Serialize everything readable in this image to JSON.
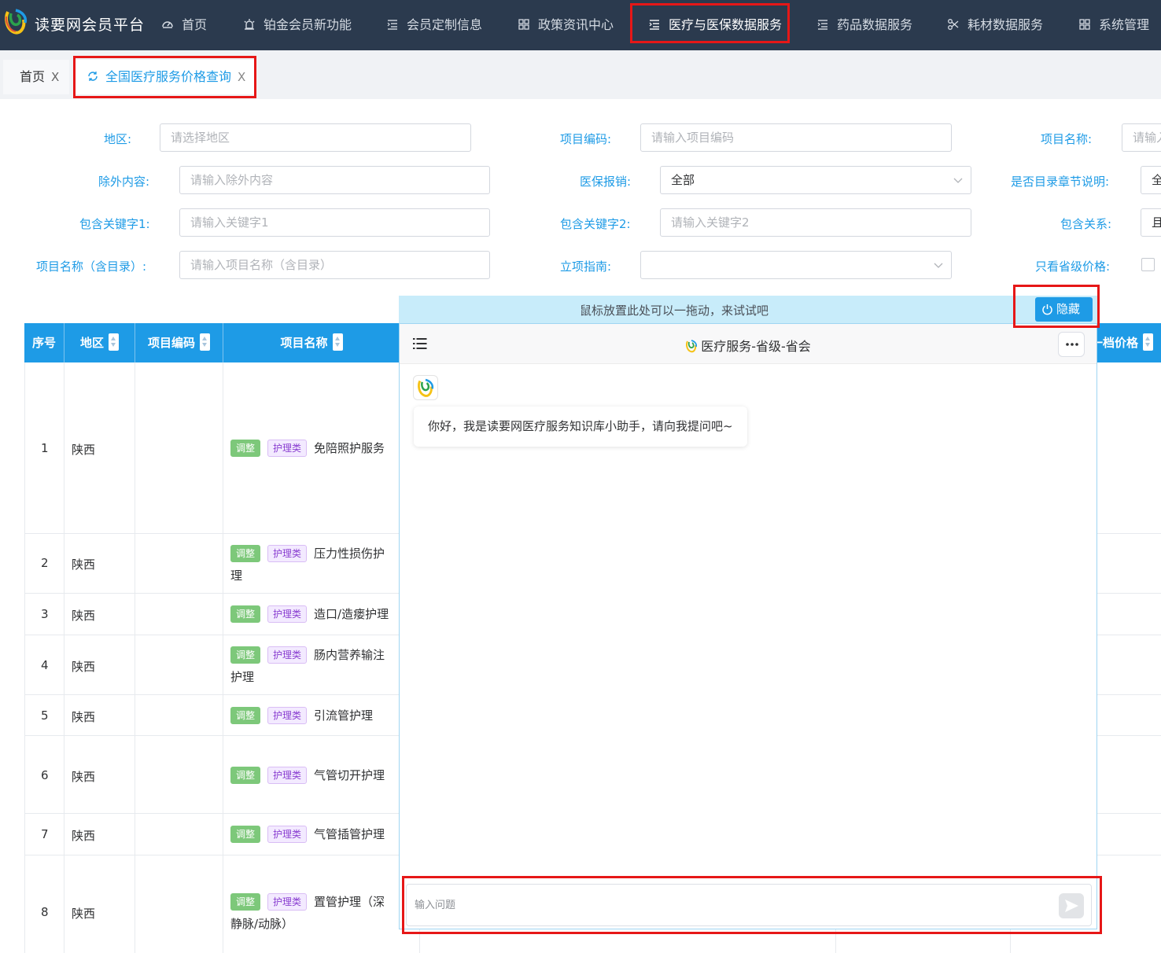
{
  "header": {
    "app_title": "读要网会员平台",
    "nav": [
      {
        "label": "首页",
        "icon": "dashboard-icon"
      },
      {
        "label": "铂金会员新功能",
        "icon": "alarm-icon"
      },
      {
        "label": "会员定制信息",
        "icon": "list-indent-icon"
      },
      {
        "label": "政策资讯中心",
        "icon": "grid-icon"
      },
      {
        "label": "医疗与医保数据服务",
        "icon": "list-indent-icon",
        "active": true
      },
      {
        "label": "药品数据服务",
        "icon": "list-indent-icon"
      },
      {
        "label": "耗材数据服务",
        "icon": "scissors-icon"
      },
      {
        "label": "系统管理",
        "icon": "grid-icon"
      }
    ]
  },
  "tabs": {
    "home": "首页",
    "active": "全国医疗服务价格查询",
    "close": "X"
  },
  "form": {
    "region": {
      "label": "地区:",
      "placeholder": "请选择地区"
    },
    "code": {
      "label": "项目编码:",
      "placeholder": "请输入项目编码"
    },
    "name": {
      "label": "项目名称:",
      "placeholder": "请输入"
    },
    "exclude": {
      "label": "除外内容:",
      "placeholder": "请输入除外内容"
    },
    "reimburse": {
      "label": "医保报销:",
      "value": "全部"
    },
    "chapter": {
      "label": "是否目录章节说明:",
      "value": "全"
    },
    "kw1": {
      "label": "包含关键字1:",
      "placeholder": "请输入关键字1"
    },
    "kw2": {
      "label": "包含关键字2:",
      "placeholder": "请输入关键字2"
    },
    "relation": {
      "label": "包含关系:",
      "value": "且"
    },
    "name_dir": {
      "label": "项目名称（含目录）:",
      "placeholder": "请输入项目名称（含目录）"
    },
    "guide": {
      "label": "立项指南:",
      "value": ""
    },
    "province_only": {
      "label": "只看省级价格:",
      "checked": false
    }
  },
  "table": {
    "columns": {
      "index": "序号",
      "region": "地区",
      "code": "项目编码",
      "name": "项目名称",
      "price1": "一档价格"
    },
    "tag_adjust": "调整",
    "tag_category": "护理类",
    "rows": [
      {
        "index": "1",
        "region": "陕西",
        "code": "",
        "name": "免陪照护服务",
        "name2": ""
      },
      {
        "index": "2",
        "region": "陕西",
        "code": "",
        "name": "压力性损伤护",
        "name2": "理"
      },
      {
        "index": "3",
        "region": "陕西",
        "code": "",
        "name": "造口/造瘘护理",
        "name2": ""
      },
      {
        "index": "4",
        "region": "陕西",
        "code": "",
        "name": "肠内营养输注",
        "name2": "护理"
      },
      {
        "index": "5",
        "region": "陕西",
        "code": "",
        "name": "引流管护理",
        "name2": ""
      },
      {
        "index": "6",
        "region": "陕西",
        "code": "",
        "name": "气管切开护理",
        "name2": ""
      },
      {
        "index": "7",
        "region": "陕西",
        "code": "",
        "name": "气管插管护理",
        "name2": ""
      },
      {
        "index": "8",
        "region": "陕西",
        "code": "",
        "name": "置管护理（深",
        "name2": "静脉/动脉）"
      }
    ]
  },
  "chat": {
    "drag_hint": "鼠标放置此处可以一拖动，来试试吧",
    "hide_label": "隐藏",
    "title": "医疗服务-省级-省会",
    "greeting": "你好，我是读要网医疗服务知识库小助手，请向我提问吧~",
    "input_placeholder": "输入问题"
  },
  "colors": {
    "accent": "#1e9be6",
    "nav_bg": "#2b3a4e",
    "highlight": "#e61717",
    "tag_adjust": "#7dc87a",
    "tag_category": "#8a3fd1"
  }
}
